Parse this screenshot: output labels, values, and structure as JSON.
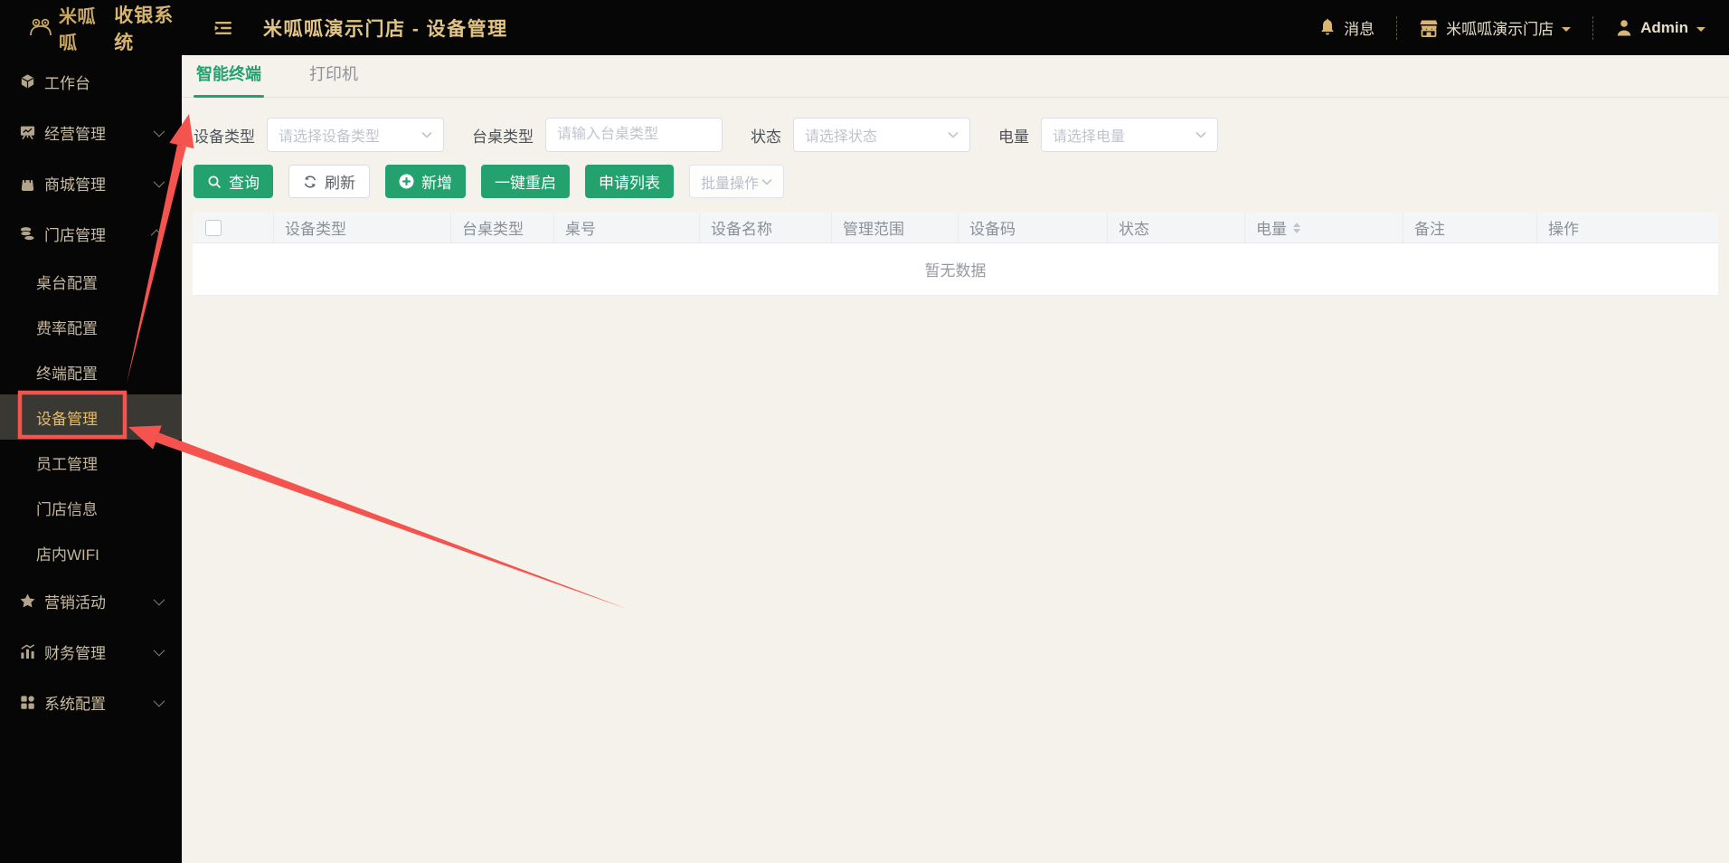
{
  "topbar": {
    "logo_brand": "米呱呱",
    "logo_product": "收银系统",
    "page_title": "米呱呱演示门店 - 设备管理",
    "messages": "消息",
    "store_name": "米呱呱演示门店",
    "username": "Admin"
  },
  "sidebar": {
    "items": [
      {
        "label": "工作台"
      },
      {
        "label": "经营管理",
        "collapsed": true
      },
      {
        "label": "商城管理",
        "collapsed": true
      },
      {
        "label": "门店管理",
        "expanded": true
      },
      {
        "label": "桌台配置"
      },
      {
        "label": "费率配置"
      },
      {
        "label": "终端配置"
      },
      {
        "label": "设备管理",
        "active": true
      },
      {
        "label": "员工管理"
      },
      {
        "label": "门店信息"
      },
      {
        "label": "店内WIFI"
      },
      {
        "label": "营销活动",
        "collapsed": true
      },
      {
        "label": "财务管理",
        "collapsed": true
      },
      {
        "label": "系统配置",
        "collapsed": true
      }
    ]
  },
  "tabs": {
    "smart_terminal": "智能终端",
    "printer": "打印机"
  },
  "filters": {
    "device_type": {
      "label": "设备类型",
      "placeholder": "请选择设备类型"
    },
    "table_type": {
      "label": "台桌类型",
      "placeholder": "请输入台桌类型"
    },
    "status": {
      "label": "状态",
      "placeholder": "请选择状态"
    },
    "battery": {
      "label": "电量",
      "placeholder": "请选择电量"
    }
  },
  "toolbar": {
    "search": "查询",
    "refresh": "刷新",
    "add": "新增",
    "reboot_all": "一键重启",
    "apply_list": "申请列表",
    "batch": "批量操作"
  },
  "table": {
    "columns": [
      "设备类型",
      "台桌类型",
      "桌号",
      "设备名称",
      "管理范围",
      "设备码",
      "状态",
      "电量",
      "备注",
      "操作"
    ],
    "empty": "暂无数据"
  },
  "colors": {
    "accent_green": "#23a26d",
    "brand_gold": "#d7b56f",
    "annotation_red": "#f4534e",
    "content_bg": "#f4f2eb"
  }
}
